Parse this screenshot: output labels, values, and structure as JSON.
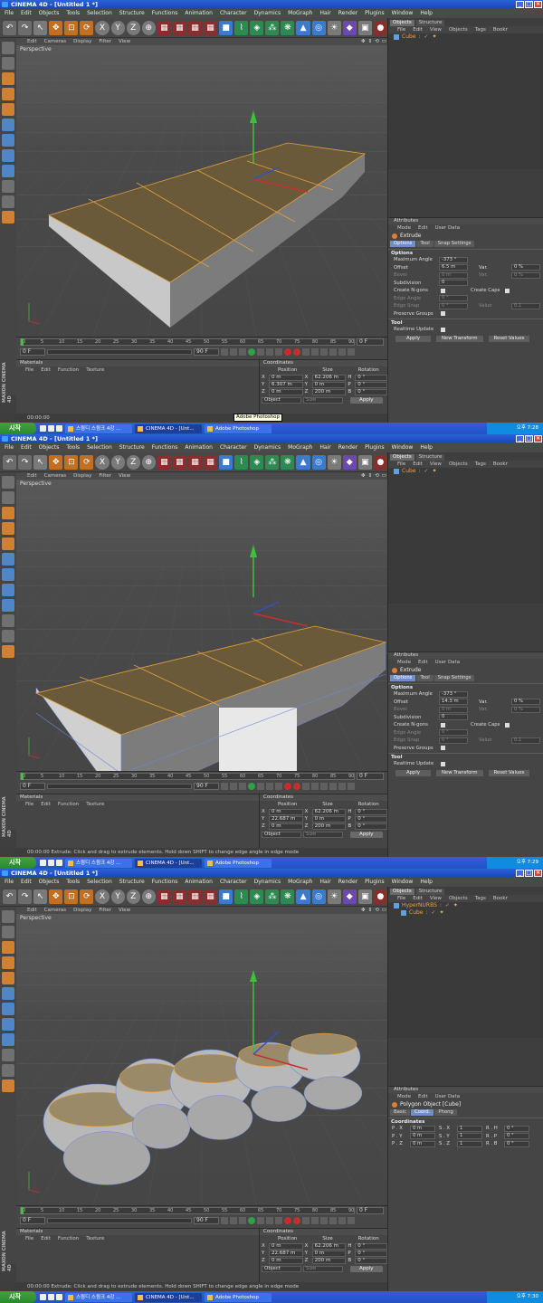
{
  "app": {
    "window_title": "CINEMA 4D - [Untitled 1 *]",
    "menus": [
      "File",
      "Edit",
      "Objects",
      "Tools",
      "Selection",
      "Structure",
      "Functions",
      "Animation",
      "Character",
      "Dynamics",
      "MoGraph",
      "Hair",
      "Render",
      "Plugins",
      "Window",
      "Help"
    ],
    "viewport_menus": [
      "Edit",
      "Cameras",
      "Display",
      "Filter",
      "View"
    ],
    "viewport_label": "Perspective",
    "objects_tabs": [
      "Objects",
      "Structure"
    ],
    "objects_menus": [
      "File",
      "Edit",
      "View",
      "Objects",
      "Tags",
      "Bookr"
    ],
    "attributes_title": "Attributes",
    "attributes_menus": [
      "Mode",
      "Edit",
      "User Data"
    ],
    "materials_title": "Materials",
    "materials_menus": [
      "File",
      "Edit",
      "Function",
      "Texture"
    ],
    "coordinates_title": "Coordinates",
    "coord_headers": [
      "Position",
      "Size",
      "Rotation"
    ],
    "maxon_logo": "MAXON CINEMA 4D",
    "timeline_ticks": [
      "0",
      "5",
      "10",
      "15",
      "20",
      "25",
      "30",
      "35",
      "40",
      "45",
      "50",
      "55",
      "60",
      "65",
      "70",
      "75",
      "80",
      "85",
      "90"
    ],
    "frame_field": "0 F",
    "start_field": "0 F",
    "end_field": "90 F",
    "start_button": "시작",
    "taskbar_items": [
      "스윙디 스윙크 4강 ...",
      "CINEMA 4D - [Unt...",
      "Adobe Photoshop"
    ]
  },
  "shots": [
    {
      "objects": [
        {
          "name": "Cube",
          "icon": "cube-icon",
          "indent": 0
        }
      ],
      "attr_object": "Extrude",
      "attr_tabs": [
        "Options",
        "Tool",
        "Snap Settings"
      ],
      "attr_active_tab": "Options",
      "extrude": {
        "section_options": "Options",
        "max_angle_label": "Maximum Angle",
        "max_angle": "-373 °",
        "offset_label": "Offset",
        "offset": "6.5 m",
        "var_label": "Var.",
        "var": "0 %",
        "bevel_label": "Bevel",
        "bevel": "0 m",
        "var2_label": "Var.",
        "var2": "0 %",
        "subdivision_label": "Subdivision",
        "subdivision": "0",
        "create_ngons_label": "Create N-gons",
        "create_caps_label": "Create Caps",
        "edge_angle_label": "Edge Angle",
        "edge_angle": "0 °",
        "edge_snap_label": "Edge Snap",
        "edge_snap": "0 °",
        "value_label": "Value",
        "value": "0.1",
        "preserve_label": "Preserve Groups",
        "section_tool": "Tool",
        "realtime_label": "Realtime Update",
        "apply_label": "Apply",
        "new_transform_label": "New Transform",
        "reset_label": "Reset Values"
      },
      "coords": {
        "rows": [
          {
            "axis": "X",
            "pos": "0 m",
            "size_axis": "X",
            "size": "62.206 m",
            "rot_axis": "H",
            "rot": "0 °"
          },
          {
            "axis": "Y",
            "pos": "6.307 m",
            "size_axis": "Y",
            "size": "0 m",
            "rot_axis": "P",
            "rot": "0 °"
          },
          {
            "axis": "Z",
            "pos": "0 m",
            "size_axis": "Z",
            "size": "200 m",
            "rot_axis": "B",
            "rot": "0 °"
          }
        ],
        "mode": "Object",
        "size_mode": "Size",
        "apply": "Apply"
      },
      "status": "00:00:00",
      "tooltip": "Adobe Photoshop",
      "clock": "오후 7:28",
      "scene": "flat"
    },
    {
      "objects": [
        {
          "name": "Cube",
          "icon": "cube-icon",
          "indent": 0
        }
      ],
      "attr_object": "Extrude",
      "attr_tabs": [
        "Options",
        "Tool",
        "Snap Settings"
      ],
      "attr_active_tab": "Options",
      "extrude": {
        "section_options": "Options",
        "max_angle_label": "Maximum Angle",
        "max_angle": "-373 °",
        "offset_label": "Offset",
        "offset": "14.3 m",
        "var_label": "Var.",
        "var": "0 %",
        "bevel_label": "Bevel",
        "bevel": "0 m",
        "var2_label": "Var.",
        "var2": "0 %",
        "subdivision_label": "Subdivision",
        "subdivision": "0",
        "create_ngons_label": "Create N-gons",
        "create_caps_label": "Create Caps",
        "edge_angle_label": "Edge Angle",
        "edge_angle": "0 °",
        "edge_snap_label": "Edge Snap",
        "edge_snap": "0 °",
        "value_label": "Value",
        "value": "0.1",
        "preserve_label": "Preserve Groups",
        "section_tool": "Tool",
        "realtime_label": "Realtime Update",
        "apply_label": "Apply",
        "new_transform_label": "New Transform",
        "reset_label": "Reset Values"
      },
      "coords": {
        "rows": [
          {
            "axis": "X",
            "pos": "0 m",
            "size_axis": "X",
            "size": "62.206 m",
            "rot_axis": "H",
            "rot": "0 °"
          },
          {
            "axis": "Y",
            "pos": "22.687 m",
            "size_axis": "Y",
            "size": "0 m",
            "rot_axis": "P",
            "rot": "0 °"
          },
          {
            "axis": "Z",
            "pos": "0 m",
            "size_axis": "Z",
            "size": "200 m",
            "rot_axis": "B",
            "rot": "0 °"
          }
        ],
        "mode": "Object",
        "size_mode": "Size",
        "apply": "Apply"
      },
      "status": "00:00:00  Extrude: Click and drag to extrude elements. Hold down SHIFT to change edge angle in edge mode",
      "tooltip": "",
      "clock": "오후 7:29",
      "scene": "extruded"
    },
    {
      "objects": [
        {
          "name": "HyperNURBS",
          "icon": "hypernurbs-icon",
          "indent": 0
        },
        {
          "name": "Cube",
          "icon": "cube-icon",
          "indent": 1
        }
      ],
      "attr_object": "Polygon Object [Cube]",
      "attr_tabs": [
        "Basic",
        "Coord.",
        "Phong"
      ],
      "attr_active_tab": "Coord.",
      "coord_section": "Coordinates",
      "poly_rows": [
        {
          "a": "P . X",
          "av": "0 m",
          "b": "S . X",
          "bv": "1",
          "c": "R . H",
          "cv": "0 °"
        },
        {
          "a": "P . Y",
          "av": "0 m",
          "b": "S . Y",
          "bv": "1",
          "c": "R . P",
          "cv": "0 °"
        },
        {
          "a": "P . Z",
          "av": "0 m",
          "b": "S . Z",
          "bv": "1",
          "c": "R . B",
          "cv": "0 °"
        }
      ],
      "coords": {
        "rows": [
          {
            "axis": "X",
            "pos": "0 m",
            "size_axis": "X",
            "size": "62.206 m",
            "rot_axis": "H",
            "rot": "0 °"
          },
          {
            "axis": "Y",
            "pos": "22.687 m",
            "size_axis": "Y",
            "size": "0 m",
            "rot_axis": "P",
            "rot": "0 °"
          },
          {
            "axis": "Z",
            "pos": "0 m",
            "size_axis": "Z",
            "size": "200 m",
            "rot_axis": "B",
            "rot": "0 °"
          }
        ],
        "mode": "Object",
        "size_mode": "Size",
        "apply": "Apply"
      },
      "status": "00:00:00  Extrude: Click and drag to extrude elements. Hold down SHIFT to change edge angle in edge mode",
      "tooltip": "",
      "clock": "오후 7:30",
      "scene": "smooth"
    }
  ]
}
